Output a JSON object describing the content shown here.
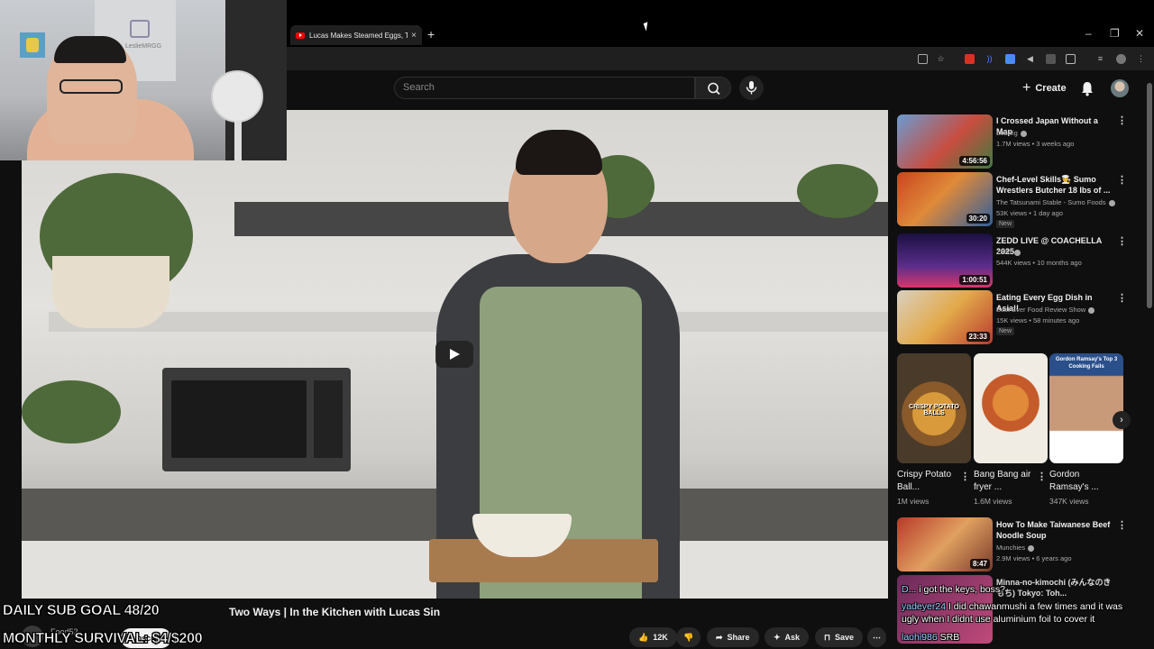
{
  "browser": {
    "tab_title": "Lucas Makes Steamed Eggs, Tw",
    "tab_close": "×",
    "new_tab": "+",
    "window_controls": [
      "–",
      "❐",
      "✕"
    ]
  },
  "youtube_header": {
    "search_placeholder": "Search",
    "create_label": "Create"
  },
  "webcam": {
    "wall_name": "LeslieMRGG"
  },
  "video": {
    "title_visible": "Two Ways | In the Kitchen with Lucas Sin",
    "channel": "Food52",
    "subscribe_label": "Subscribe"
  },
  "actions": {
    "like_count": "12K",
    "share_label": "Share",
    "ask_label": "Ask",
    "save_label": "Save"
  },
  "recommendations": [
    {
      "title": "I Crossed Japan Without a Map",
      "channel": "Ludwig",
      "meta": "1.7M views • 3 weeks ago",
      "duration": "4:56:56",
      "new": ""
    },
    {
      "title": "Chef-Level Skills🧑‍🍳 Sumo Wrestlers Butcher 18 lbs of ...",
      "channel": "The Tatsunami Stable - Sumo Foods",
      "meta": "53K views • 1 day ago",
      "duration": "30:20",
      "new": "New"
    },
    {
      "title": "ZEDD LIVE @ COACHELLA 2025",
      "channel": "Zedd",
      "meta": "544K views • 10 months ago",
      "duration": "1:00:51",
      "new": ""
    },
    {
      "title": "Eating Every Egg Dish in Asia!!",
      "channel": "Best Ever Food Review Show",
      "meta": "15K views • 58 minutes ago",
      "duration": "23:33",
      "new": "New"
    },
    {
      "title": "How To Make Taiwanese Beef Noodle Soup",
      "channel": "Munchies",
      "meta": "2.9M views • 6 years ago",
      "duration": "8:47",
      "new": ""
    },
    {
      "title": "Minna-no-kimochi (みんなのきもち) Tokyo: Toh...",
      "channel": "",
      "meta": "",
      "duration": "",
      "new": ""
    }
  ],
  "shorts": [
    {
      "title": "Crispy Potato Ball...",
      "views": "1M views",
      "overlay": "CRISPY POTATO BALLS"
    },
    {
      "title": "Bang Bang air fryer ...",
      "views": "1.6M views",
      "overlay": ""
    },
    {
      "title": "Gordon Ramsay's ...",
      "views": "347K views",
      "overlay": "Gordon Ramsay's Top 3 Cooking Fails"
    }
  ],
  "overlay": {
    "goal_line_1": "DAILY SUB GOAL 48/20",
    "goal_line_2": "MONTHLY SURVIVAL: $4/$200"
  },
  "chat": [
    {
      "user": "D...",
      "text": "i got the keys, boss?"
    },
    {
      "user": "yadeyer24",
      "text": "I did chawanmushi a few times and it was"
    },
    {
      "user": "",
      "text": "ugly when I didnt use aluminium foil to cover it"
    },
    {
      "user": "laohi986",
      "text": "SRB"
    }
  ],
  "colors": {
    "youtube_red": "#ff0000",
    "page_bg": "#0f0f0f",
    "text_primary": "#f1f1f1",
    "text_secondary": "#aaaaaa"
  }
}
